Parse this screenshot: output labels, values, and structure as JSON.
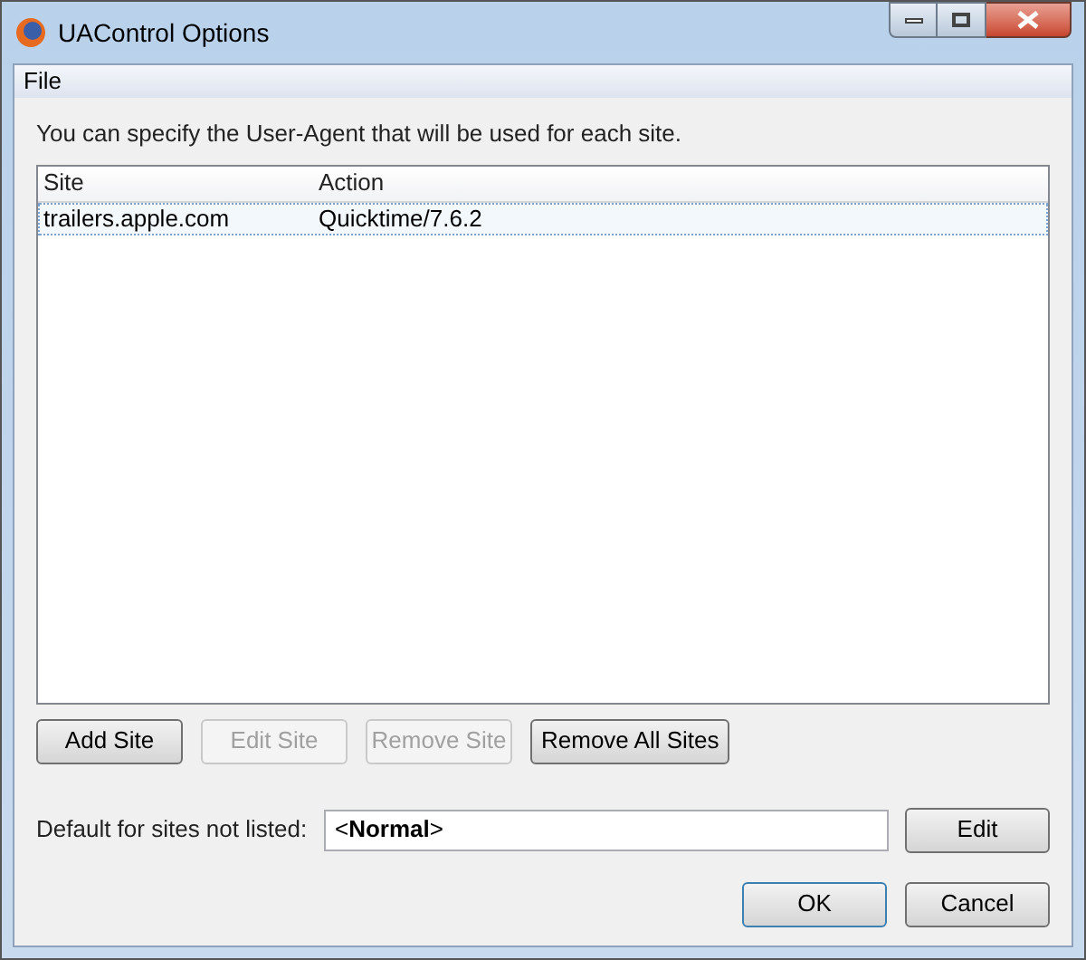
{
  "window": {
    "title": "UAControl Options"
  },
  "menu": [
    {
      "label": "File"
    }
  ],
  "intro": "You can specify the User-Agent that will be used for each site.",
  "table": {
    "columns": [
      "Site",
      "Action"
    ],
    "rows": [
      {
        "cells": [
          "trailers.apple.com",
          "Quicktime/7.6.2"
        ],
        "selected": true
      }
    ]
  },
  "site_buttons": [
    {
      "label": "Add Site",
      "disabled": false
    },
    {
      "label": "Edit Site",
      "disabled": true
    },
    {
      "label": "Remove Site",
      "disabled": true
    },
    {
      "label": "Remove All Sites",
      "disabled": false
    }
  ],
  "default_row": {
    "label": "Default for sites not listed:",
    "value": "<**Normal**>",
    "button": "Edit"
  },
  "dialog_buttons": [
    {
      "label": "OK",
      "default": true
    },
    {
      "label": "Cancel",
      "default": false
    }
  ]
}
